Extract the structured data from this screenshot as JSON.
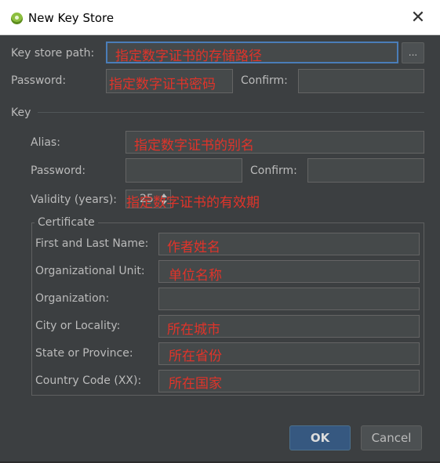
{
  "window": {
    "title": "New Key Store"
  },
  "keystore": {
    "path_label": "Key store path:",
    "path_value": "指定数字证书的存储路径",
    "browse_label": "...",
    "password_label": "Password:",
    "password_value": "指定数字证书密码",
    "confirm_label": "Confirm:"
  },
  "key": {
    "section_label": "Key",
    "alias_label": "Alias:",
    "alias_value": "指定数字证书的别名",
    "password_label": "Password:",
    "confirm_label": "Confirm:",
    "validity_label": "Validity (years):",
    "validity_value": "25",
    "validity_note": "指定数字证书的有效期"
  },
  "certificate": {
    "legend": "Certificate",
    "fields": [
      {
        "label": "First and Last Name:",
        "value": "作者姓名"
      },
      {
        "label": "Organizational Unit:",
        "value": "单位名称"
      },
      {
        "label": "Organization:",
        "value": ""
      },
      {
        "label": "City or Locality:",
        "value": "所在城市"
      },
      {
        "label": "State or Province:",
        "value": "所在省份"
      },
      {
        "label": "Country Code (XX):",
        "value": "所在国家"
      }
    ]
  },
  "buttons": {
    "ok": "OK",
    "cancel": "Cancel"
  }
}
